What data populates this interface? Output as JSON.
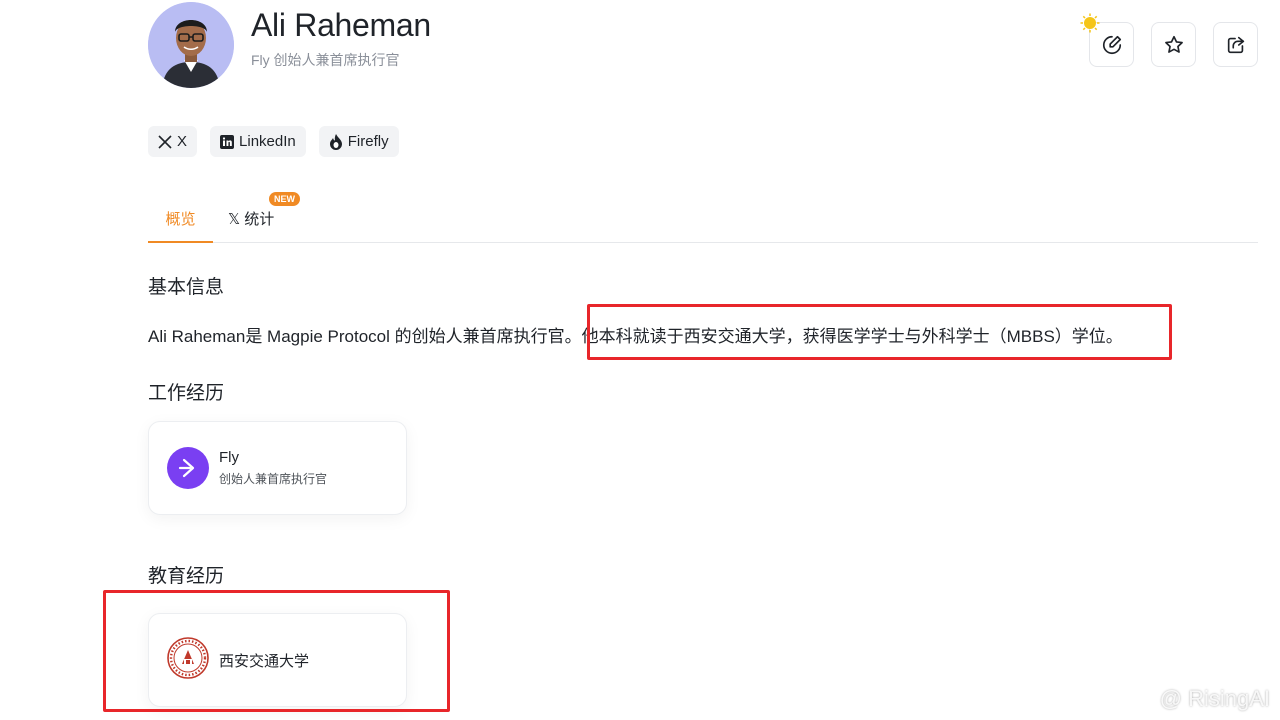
{
  "profile": {
    "name": "Ali Raheman",
    "subtitle": "Fly 创始人兼首席执行官"
  },
  "socials": [
    {
      "label": "X",
      "icon": "x-icon"
    },
    {
      "label": "LinkedIn",
      "icon": "linkedin-icon"
    },
    {
      "label": "Firefly",
      "icon": "firefly-icon"
    }
  ],
  "actions": {
    "edit_icon": "edit-icon",
    "favorite_icon": "star-icon",
    "share_icon": "share-icon"
  },
  "tabs": {
    "overview": "概览",
    "stats_prefix": "𝕏",
    "stats": "统计",
    "new_badge": "NEW"
  },
  "sections": {
    "basic_info": "基本信息",
    "work": "工作经历",
    "education": "教育经历"
  },
  "bio": {
    "part1": "Ali Raheman是 Magpie Protocol 的创始人兼首席执行官。",
    "part2": "他本科就读于西安交通大学，获得医学学士与外科学士（MBBS）学位。"
  },
  "work": [
    {
      "company": "Fly",
      "role": "创始人兼首席执行官"
    }
  ],
  "education": [
    {
      "school": "西安交通大学"
    }
  ],
  "watermark": "@ RisingAI",
  "colors": {
    "accent": "#f08a24",
    "highlight": "#e8262a",
    "fly_brand": "#7a3ff2"
  }
}
